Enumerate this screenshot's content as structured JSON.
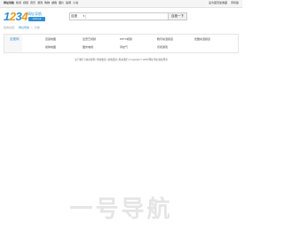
{
  "topbar": {
    "links": [
      "网址导航",
      "新闻",
      "视频",
      "音乐",
      "游戏",
      "购物",
      "邮箱",
      "图片",
      "贴吧",
      "小说"
    ],
    "right_links": [
      "设为首页加收藏",
      "手机版"
    ]
  },
  "logo": {
    "digits": [
      "1",
      "2",
      "3",
      "4"
    ],
    "subtitle": "网址导航",
    "badge": "123.ink"
  },
  "search": {
    "engine": "百度",
    "placeholder": "",
    "button_label": "百度一下"
  },
  "breadcrumb": {
    "prefix": "您的位置：",
    "home": "网址导航",
    "sep": ">",
    "current": "分类"
  },
  "categories": {
    "title": "百度网",
    "items": [
      "百度地图",
      "爱奇艺视频",
      "PPTV视频",
      "腾讯动漫频道",
      "优酷动漫频道",
      "搜狗地图",
      "酷米电视",
      "风炫气",
      "乐视游戏"
    ]
  },
  "footer": {
    "text": "关于我们 | 收录说明 | 申请收录 | 友情链接 | 联系我们 | Copyright © 2018 网址导航 版权所有"
  },
  "watermark": {
    "text": "一号导航"
  }
}
